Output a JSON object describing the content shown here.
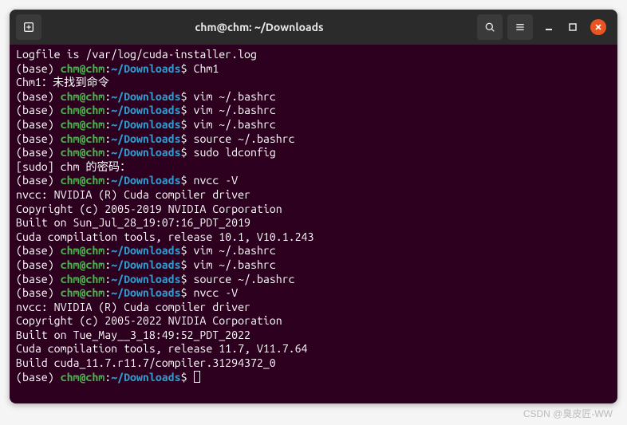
{
  "titlebar": {
    "title": "chm@chm: ~/Downloads"
  },
  "prompt": {
    "base": "(base) ",
    "userhost": "chm@chm",
    "colon": ":",
    "path": "~/Downloads",
    "dollar": "$ "
  },
  "lines": [
    {
      "type": "plain",
      "text": "Logfile is /var/log/cuda-installer.log"
    },
    {
      "type": "prompt",
      "cmd": "Chm1"
    },
    {
      "type": "plain",
      "text": "Chm1：未找到命令"
    },
    {
      "type": "prompt",
      "cmd": "vim ~/.bashrc"
    },
    {
      "type": "prompt",
      "cmd": "vim ~/.bashrc"
    },
    {
      "type": "prompt",
      "cmd": "vim ~/.bashrc"
    },
    {
      "type": "prompt",
      "cmd": "source ~/.bashrc"
    },
    {
      "type": "prompt",
      "cmd": "sudo ldconfig"
    },
    {
      "type": "plain",
      "text": "[sudo] chm 的密码："
    },
    {
      "type": "prompt",
      "cmd": "nvcc -V"
    },
    {
      "type": "plain",
      "text": "nvcc: NVIDIA (R) Cuda compiler driver"
    },
    {
      "type": "plain",
      "text": "Copyright (c) 2005-2019 NVIDIA Corporation"
    },
    {
      "type": "plain",
      "text": "Built on Sun_Jul_28_19:07:16_PDT_2019"
    },
    {
      "type": "plain",
      "text": "Cuda compilation tools, release 10.1, V10.1.243"
    },
    {
      "type": "prompt",
      "cmd": "vim ~/.bashrc"
    },
    {
      "type": "prompt",
      "cmd": "vim ~/.bashrc"
    },
    {
      "type": "prompt",
      "cmd": "source ~/.bashrc"
    },
    {
      "type": "prompt",
      "cmd": "nvcc -V"
    },
    {
      "type": "plain",
      "text": "nvcc: NVIDIA (R) Cuda compiler driver"
    },
    {
      "type": "plain",
      "text": "Copyright (c) 2005-2022 NVIDIA Corporation"
    },
    {
      "type": "plain",
      "text": "Built on Tue_May__3_18:49:52_PDT_2022"
    },
    {
      "type": "plain",
      "text": "Cuda compilation tools, release 11.7, V11.7.64"
    },
    {
      "type": "plain",
      "text": "Build cuda_11.7.r11.7/compiler.31294372_0"
    },
    {
      "type": "prompt_cursor",
      "cmd": ""
    }
  ],
  "watermark": "CSDN @臭皮匠-WW"
}
